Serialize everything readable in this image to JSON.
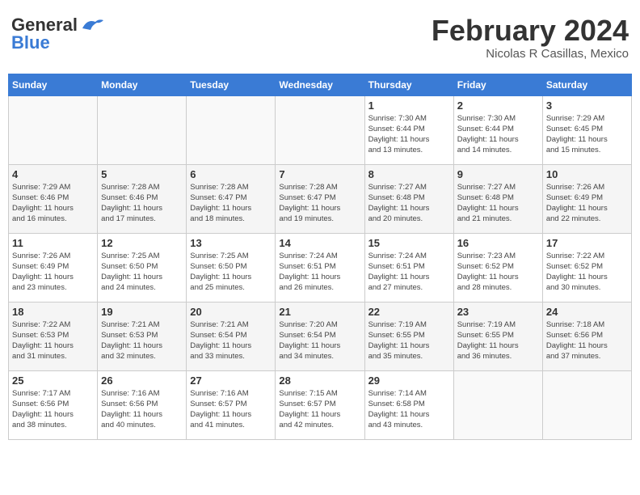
{
  "header": {
    "logo_general": "General",
    "logo_blue": "Blue",
    "title": "February 2024",
    "subtitle": "Nicolas R Casillas, Mexico"
  },
  "weekdays": [
    "Sunday",
    "Monday",
    "Tuesday",
    "Wednesday",
    "Thursday",
    "Friday",
    "Saturday"
  ],
  "weeks": [
    [
      {
        "day": "",
        "info": ""
      },
      {
        "day": "",
        "info": ""
      },
      {
        "day": "",
        "info": ""
      },
      {
        "day": "",
        "info": ""
      },
      {
        "day": "1",
        "info": "Sunrise: 7:30 AM\nSunset: 6:44 PM\nDaylight: 11 hours\nand 13 minutes."
      },
      {
        "day": "2",
        "info": "Sunrise: 7:30 AM\nSunset: 6:44 PM\nDaylight: 11 hours\nand 14 minutes."
      },
      {
        "day": "3",
        "info": "Sunrise: 7:29 AM\nSunset: 6:45 PM\nDaylight: 11 hours\nand 15 minutes."
      }
    ],
    [
      {
        "day": "4",
        "info": "Sunrise: 7:29 AM\nSunset: 6:46 PM\nDaylight: 11 hours\nand 16 minutes."
      },
      {
        "day": "5",
        "info": "Sunrise: 7:28 AM\nSunset: 6:46 PM\nDaylight: 11 hours\nand 17 minutes."
      },
      {
        "day": "6",
        "info": "Sunrise: 7:28 AM\nSunset: 6:47 PM\nDaylight: 11 hours\nand 18 minutes."
      },
      {
        "day": "7",
        "info": "Sunrise: 7:28 AM\nSunset: 6:47 PM\nDaylight: 11 hours\nand 19 minutes."
      },
      {
        "day": "8",
        "info": "Sunrise: 7:27 AM\nSunset: 6:48 PM\nDaylight: 11 hours\nand 20 minutes."
      },
      {
        "day": "9",
        "info": "Sunrise: 7:27 AM\nSunset: 6:48 PM\nDaylight: 11 hours\nand 21 minutes."
      },
      {
        "day": "10",
        "info": "Sunrise: 7:26 AM\nSunset: 6:49 PM\nDaylight: 11 hours\nand 22 minutes."
      }
    ],
    [
      {
        "day": "11",
        "info": "Sunrise: 7:26 AM\nSunset: 6:49 PM\nDaylight: 11 hours\nand 23 minutes."
      },
      {
        "day": "12",
        "info": "Sunrise: 7:25 AM\nSunset: 6:50 PM\nDaylight: 11 hours\nand 24 minutes."
      },
      {
        "day": "13",
        "info": "Sunrise: 7:25 AM\nSunset: 6:50 PM\nDaylight: 11 hours\nand 25 minutes."
      },
      {
        "day": "14",
        "info": "Sunrise: 7:24 AM\nSunset: 6:51 PM\nDaylight: 11 hours\nand 26 minutes."
      },
      {
        "day": "15",
        "info": "Sunrise: 7:24 AM\nSunset: 6:51 PM\nDaylight: 11 hours\nand 27 minutes."
      },
      {
        "day": "16",
        "info": "Sunrise: 7:23 AM\nSunset: 6:52 PM\nDaylight: 11 hours\nand 28 minutes."
      },
      {
        "day": "17",
        "info": "Sunrise: 7:22 AM\nSunset: 6:52 PM\nDaylight: 11 hours\nand 30 minutes."
      }
    ],
    [
      {
        "day": "18",
        "info": "Sunrise: 7:22 AM\nSunset: 6:53 PM\nDaylight: 11 hours\nand 31 minutes."
      },
      {
        "day": "19",
        "info": "Sunrise: 7:21 AM\nSunset: 6:53 PM\nDaylight: 11 hours\nand 32 minutes."
      },
      {
        "day": "20",
        "info": "Sunrise: 7:21 AM\nSunset: 6:54 PM\nDaylight: 11 hours\nand 33 minutes."
      },
      {
        "day": "21",
        "info": "Sunrise: 7:20 AM\nSunset: 6:54 PM\nDaylight: 11 hours\nand 34 minutes."
      },
      {
        "day": "22",
        "info": "Sunrise: 7:19 AM\nSunset: 6:55 PM\nDaylight: 11 hours\nand 35 minutes."
      },
      {
        "day": "23",
        "info": "Sunrise: 7:19 AM\nSunset: 6:55 PM\nDaylight: 11 hours\nand 36 minutes."
      },
      {
        "day": "24",
        "info": "Sunrise: 7:18 AM\nSunset: 6:56 PM\nDaylight: 11 hours\nand 37 minutes."
      }
    ],
    [
      {
        "day": "25",
        "info": "Sunrise: 7:17 AM\nSunset: 6:56 PM\nDaylight: 11 hours\nand 38 minutes."
      },
      {
        "day": "26",
        "info": "Sunrise: 7:16 AM\nSunset: 6:56 PM\nDaylight: 11 hours\nand 40 minutes."
      },
      {
        "day": "27",
        "info": "Sunrise: 7:16 AM\nSunset: 6:57 PM\nDaylight: 11 hours\nand 41 minutes."
      },
      {
        "day": "28",
        "info": "Sunrise: 7:15 AM\nSunset: 6:57 PM\nDaylight: 11 hours\nand 42 minutes."
      },
      {
        "day": "29",
        "info": "Sunrise: 7:14 AM\nSunset: 6:58 PM\nDaylight: 11 hours\nand 43 minutes."
      },
      {
        "day": "",
        "info": ""
      },
      {
        "day": "",
        "info": ""
      }
    ]
  ]
}
